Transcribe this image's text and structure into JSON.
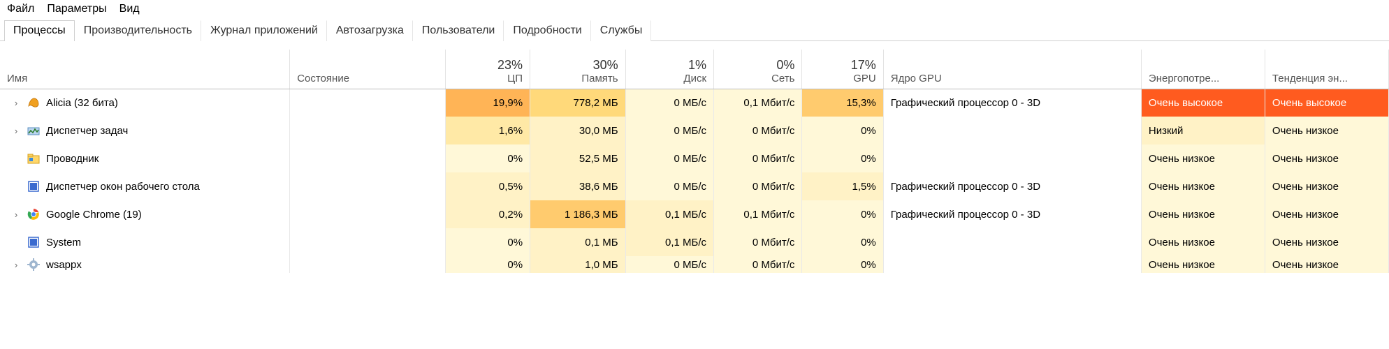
{
  "menu": {
    "items": [
      "Файл",
      "Параметры",
      "Вид"
    ]
  },
  "tabs": [
    {
      "label": "Процессы",
      "active": true
    },
    {
      "label": "Производительность",
      "active": false
    },
    {
      "label": "Журнал приложений",
      "active": false
    },
    {
      "label": "Автозагрузка",
      "active": false
    },
    {
      "label": "Пользователи",
      "active": false
    },
    {
      "label": "Подробности",
      "active": false
    },
    {
      "label": "Службы",
      "active": false
    }
  ],
  "columns": {
    "name": {
      "label": "Имя"
    },
    "state": {
      "label": "Состояние"
    },
    "cpu": {
      "top": "23%",
      "label": "ЦП"
    },
    "mem": {
      "top": "30%",
      "label": "Память"
    },
    "disk": {
      "top": "1%",
      "label": "Диск"
    },
    "net": {
      "top": "0%",
      "label": "Сеть"
    },
    "gpu": {
      "top": "17%",
      "label": "GPU"
    },
    "gpucore": {
      "label": "Ядро GPU"
    },
    "energy": {
      "label": "Энергопотре..."
    },
    "trend": {
      "label": "Тенденция эн..."
    }
  },
  "rows": [
    {
      "expandable": true,
      "icon": "alicia",
      "name": "Alicia (32 бита)",
      "cpu": {
        "v": "19,9%",
        "heat": 6
      },
      "mem": {
        "v": "778,2 МБ",
        "heat": 4
      },
      "disk": {
        "v": "0 МБ/с",
        "heat": 1
      },
      "net": {
        "v": "0,1 Мбит/с",
        "heat": 1
      },
      "gpu": {
        "v": "15,3%",
        "heat": 5
      },
      "gpucore": "Графический процессор 0 - 3D",
      "energy": {
        "v": "Очень высокое",
        "heat": "orange"
      },
      "trend": {
        "v": "Очень высокое",
        "heat": "orange"
      }
    },
    {
      "expandable": true,
      "icon": "taskmgr",
      "name": "Диспетчер задач",
      "cpu": {
        "v": "1,6%",
        "heat": 3
      },
      "mem": {
        "v": "30,0 МБ",
        "heat": 2
      },
      "disk": {
        "v": "0 МБ/с",
        "heat": 1
      },
      "net": {
        "v": "0 Мбит/с",
        "heat": 1
      },
      "gpu": {
        "v": "0%",
        "heat": 1
      },
      "gpucore": "",
      "energy": {
        "v": "Низкий",
        "heat": 2
      },
      "trend": {
        "v": "Очень низкое",
        "heat": 1
      }
    },
    {
      "expandable": false,
      "icon": "explorer",
      "name": "Проводник",
      "cpu": {
        "v": "0%",
        "heat": 1
      },
      "mem": {
        "v": "52,5 МБ",
        "heat": 2
      },
      "disk": {
        "v": "0 МБ/с",
        "heat": 1
      },
      "net": {
        "v": "0 Мбит/с",
        "heat": 1
      },
      "gpu": {
        "v": "0%",
        "heat": 1
      },
      "gpucore": "",
      "energy": {
        "v": "Очень низкое",
        "heat": 1
      },
      "trend": {
        "v": "Очень низкое",
        "heat": 1
      }
    },
    {
      "expandable": false,
      "icon": "generic-blue",
      "name": "Диспетчер окон рабочего стола",
      "cpu": {
        "v": "0,5%",
        "heat": 2
      },
      "mem": {
        "v": "38,6 МБ",
        "heat": 2
      },
      "disk": {
        "v": "0 МБ/с",
        "heat": 1
      },
      "net": {
        "v": "0 Мбит/с",
        "heat": 1
      },
      "gpu": {
        "v": "1,5%",
        "heat": 2
      },
      "gpucore": "Графический процессор 0 - 3D",
      "energy": {
        "v": "Очень низкое",
        "heat": 1
      },
      "trend": {
        "v": "Очень низкое",
        "heat": 1
      }
    },
    {
      "expandable": true,
      "icon": "chrome",
      "name": "Google Chrome (19)",
      "cpu": {
        "v": "0,2%",
        "heat": 2
      },
      "mem": {
        "v": "1 186,3 МБ",
        "heat": 5
      },
      "disk": {
        "v": "0,1 МБ/с",
        "heat": 2
      },
      "net": {
        "v": "0,1 Мбит/с",
        "heat": 1
      },
      "gpu": {
        "v": "0%",
        "heat": 1
      },
      "gpucore": "Графический процессор 0 - 3D",
      "energy": {
        "v": "Очень низкое",
        "heat": 1
      },
      "trend": {
        "v": "Очень низкое",
        "heat": 1
      }
    },
    {
      "expandable": false,
      "icon": "generic-blue",
      "name": "System",
      "cpu": {
        "v": "0%",
        "heat": 1
      },
      "mem": {
        "v": "0,1 МБ",
        "heat": 2
      },
      "disk": {
        "v": "0,1 МБ/с",
        "heat": 2
      },
      "net": {
        "v": "0 Мбит/с",
        "heat": 1
      },
      "gpu": {
        "v": "0%",
        "heat": 1
      },
      "gpucore": "",
      "energy": {
        "v": "Очень низкое",
        "heat": 1
      },
      "trend": {
        "v": "Очень низкое",
        "heat": 1
      }
    },
    {
      "expandable": true,
      "icon": "gear",
      "name": "wsappx",
      "partial": true,
      "cpu": {
        "v": "0%",
        "heat": 1
      },
      "mem": {
        "v": "1,0 МБ",
        "heat": 2
      },
      "disk": {
        "v": "0 МБ/с",
        "heat": 1
      },
      "net": {
        "v": "0 Мбит/с",
        "heat": 1
      },
      "gpu": {
        "v": "0%",
        "heat": 1
      },
      "gpucore": "",
      "energy": {
        "v": "Очень низкое",
        "heat": 1
      },
      "trend": {
        "v": "Очень низкое",
        "heat": 1
      }
    }
  ]
}
